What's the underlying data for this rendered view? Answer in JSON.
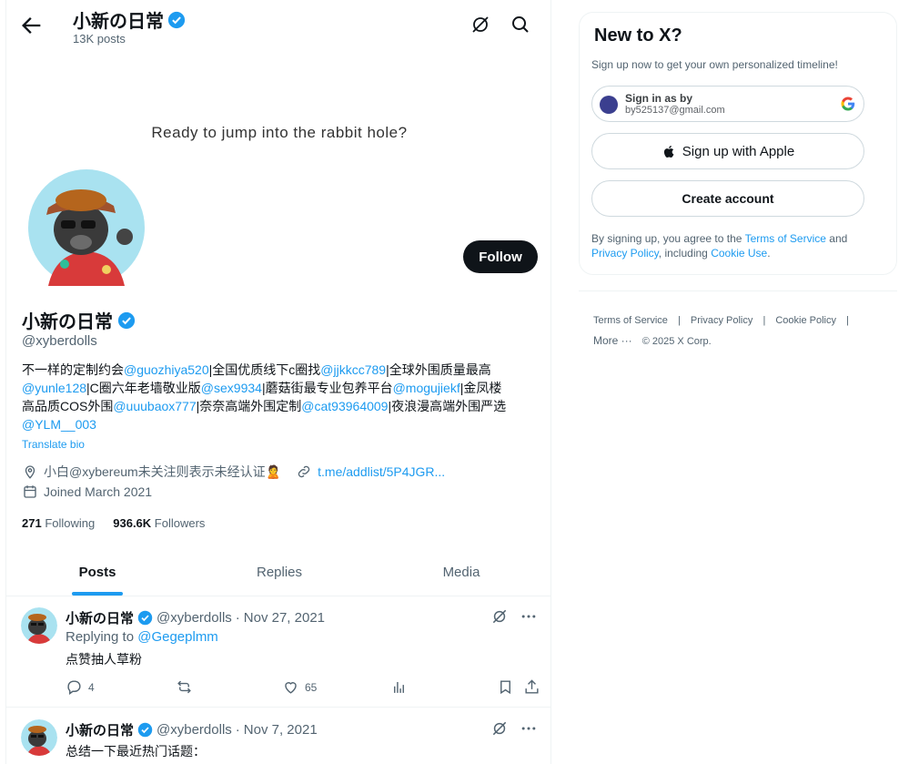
{
  "profile_header": {
    "name": "小新の日常",
    "post_count": "13K posts"
  },
  "banner": {
    "text": "Ready to jump into the rabbit hole?"
  },
  "profile": {
    "follow_label": "Follow",
    "name": "小新の日常",
    "handle": "@xyberdolls",
    "bio": [
      [
        {
          "t": "不一样的定制约会"
        },
        {
          "t": "@guozhiya520",
          "m": true
        },
        {
          "t": "|全国优质线下c圈找"
        },
        {
          "t": "@jjkkcc789",
          "m": true
        },
        {
          "t": "|全球外围质量最高"
        }
      ],
      [
        {
          "t": "@yunle128",
          "m": true
        },
        {
          "t": "|C圈六年老墙敬业版"
        },
        {
          "t": "@sex9934",
          "m": true
        },
        {
          "t": "|蘑菇街最专业包养平台"
        },
        {
          "t": "@mogujiekf",
          "m": true
        },
        {
          "t": "|金凤楼"
        }
      ],
      [
        {
          "t": "高品质COS外围"
        },
        {
          "t": "@uuubaox777",
          "m": true
        },
        {
          "t": "|奈奈高端外围定制"
        },
        {
          "t": "@cat93964009",
          "m": true
        },
        {
          "t": "|夜浪漫高端外围严选"
        }
      ],
      [
        {
          "t": "@YLM__003",
          "m": true
        }
      ]
    ],
    "translate_label": "Translate bio",
    "location": "小白@xybereum未关注则表示未经认证🙎",
    "link": "t.me/addlist/5P4JGR...",
    "joined": "Joined March 2021",
    "following_count": "271",
    "following_label": "Following",
    "followers_count": "936.6K",
    "followers_label": "Followers"
  },
  "tabs": [
    "Posts",
    "Replies",
    "Media"
  ],
  "posts": [
    {
      "name": "小新の日常",
      "handle": "@xyberdolls",
      "dot": "·",
      "date": "Nov 27, 2021",
      "replying_prefix": "Replying to",
      "replying_to": "@Gegeplmm",
      "text": "点赞抽人草粉",
      "replies": "4",
      "likes": "65"
    },
    {
      "name": "小新の日常",
      "handle": "@xyberdolls",
      "dot": "·",
      "date": "Nov 7, 2021",
      "text": "总结一下最近热门话题："
    }
  ],
  "sidebar": {
    "title": "New to X?",
    "subtitle": "Sign up now to get your own personalized timeline!",
    "google_line1": "Sign in as by",
    "google_line2": "by525137@gmail.com",
    "apple_label": "Sign up with Apple",
    "create_label": "Create account",
    "legal_prefix": "By signing up, you agree to the",
    "terms": "Terms of Service",
    "and": "and",
    "privacy": "Privacy Policy",
    "including": ", including",
    "cookie": "Cookie Use",
    "period": "."
  },
  "footer": {
    "links": [
      "Terms of Service",
      "|",
      "Privacy Policy",
      "|",
      "Cookie Policy",
      "|"
    ],
    "more": "More ···",
    "copyright": "© 2025 X Corp."
  },
  "colors": {
    "accent": "#1d9bf0",
    "text": "#0f1419",
    "secondary": "#536471",
    "border": "#eff3f4"
  }
}
